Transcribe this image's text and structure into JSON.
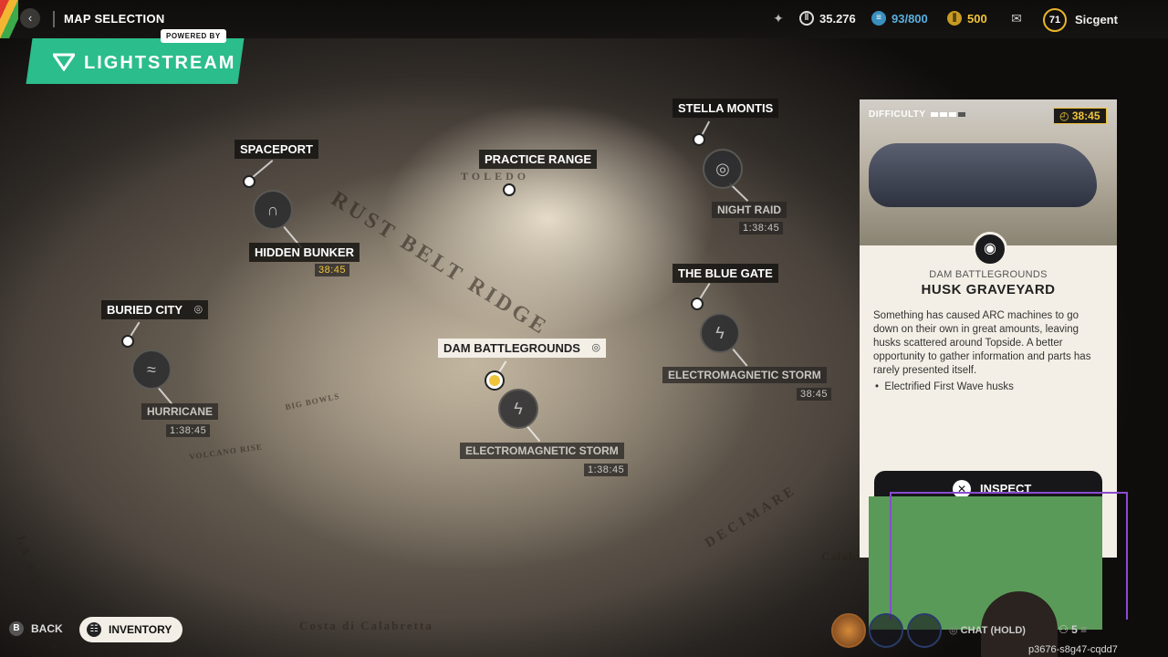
{
  "header": {
    "title": "MAP SELECTION",
    "stats": {
      "currency": "35.276",
      "capacity": "93/800",
      "tokens": "500",
      "level": "71",
      "username": "Sicgent"
    }
  },
  "overlay": {
    "brand": "LIGHTSTREAM",
    "powered_by": "POWERED BY"
  },
  "map": {
    "terrain": {
      "rust_belt_ridge": "RUST BELT RIDGE",
      "toledo": "TOLEDO",
      "big_bowls": "BIG BOWLS",
      "volcano_rise": "VOLCANO RISE",
      "la_cartiera": "LA CARTIERA",
      "decimare": "DECIMARE",
      "calabria": "Calabr",
      "coast": "Costa di Calabretta"
    },
    "locations": {
      "spaceport": {
        "name": "SPACEPORT"
      },
      "hidden_bunker": {
        "name": "HIDDEN BUNKER",
        "timer": "38:45"
      },
      "practice_range": {
        "name": "PRACTICE RANGE"
      },
      "stella_montis": {
        "name": "STELLA MONTIS"
      },
      "night_raid": {
        "name": "NIGHT RAID",
        "timer": "1:38:45"
      },
      "buried_city": {
        "name": "BURIED CITY"
      },
      "hurricane": {
        "name": "HURRICANE",
        "timer": "1:38:45"
      },
      "dam_battlegrounds": {
        "name": "DAM BATTLEGROUNDS"
      },
      "em_storm_dam": {
        "name": "ELECTROMAGNETIC STORM",
        "timer": "1:38:45"
      },
      "blue_gate": {
        "name": "THE BLUE GATE"
      },
      "em_storm_gate": {
        "name": "ELECTROMAGNETIC STORM",
        "timer": "38:45"
      }
    }
  },
  "panel": {
    "difficulty_label": "DIFFICULTY",
    "timer": "38:45",
    "location": "DAM BATTLEGROUNDS",
    "title": "HUSK GRAVEYARD",
    "description": "Something has caused ARC machines to go down on their own in great amounts, leaving husks scattered around Topside. A better opportunity to gather information and parts has rarely presented itself.",
    "bullet": "Electrified First Wave husks",
    "inspect_label": "INSPECT"
  },
  "footer": {
    "back_key": "B",
    "back_label": "BACK",
    "inventory_label": "INVENTORY",
    "chat_label": "CHAT (HOLD)",
    "squad_count": "5",
    "session_code": "p3676-s8g47-cqdd7"
  }
}
